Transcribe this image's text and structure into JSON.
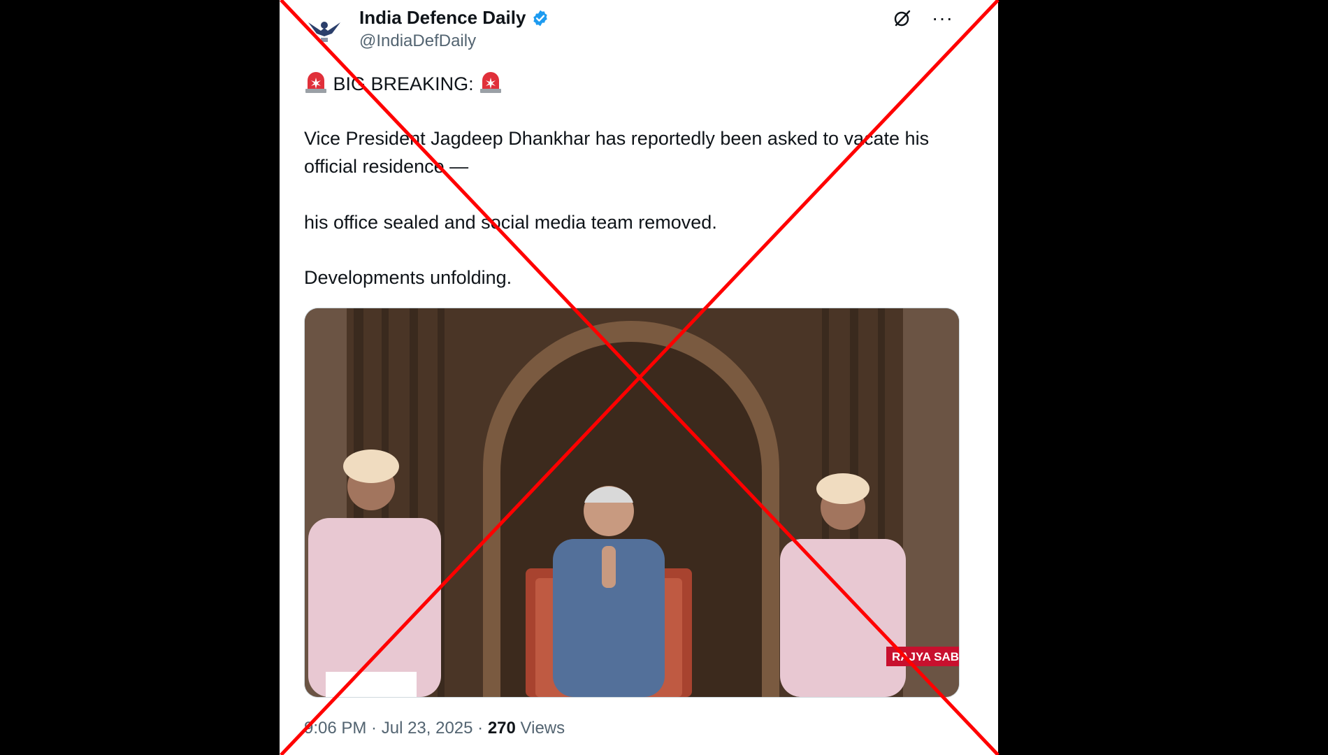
{
  "tweet": {
    "author_name": "India Defence Daily",
    "handle": "@IndiaDefDaily",
    "headline": "BIG BREAKING:",
    "paragraph1": "Vice President Jagdeep Dhankhar has reportedly been asked to vacate his official residence —",
    "paragraph2": "his office sealed and social media team removed.",
    "paragraph3": "Developments unfolding.",
    "time": "9:06 PM",
    "separator": " · ",
    "date": "Jul 23, 2025",
    "views_count": "270",
    "views_label": " Views"
  },
  "media": {
    "watermark": "RAJYA SABHA"
  },
  "icons": {
    "verified": "verified-badge-icon",
    "grok": "grok-icon",
    "more": "more-icon",
    "siren": "police-siren-icon"
  },
  "colors": {
    "verified": "#1d9bf0",
    "cross": "#ff0000",
    "text": "#0f1419",
    "muted": "#536471"
  }
}
